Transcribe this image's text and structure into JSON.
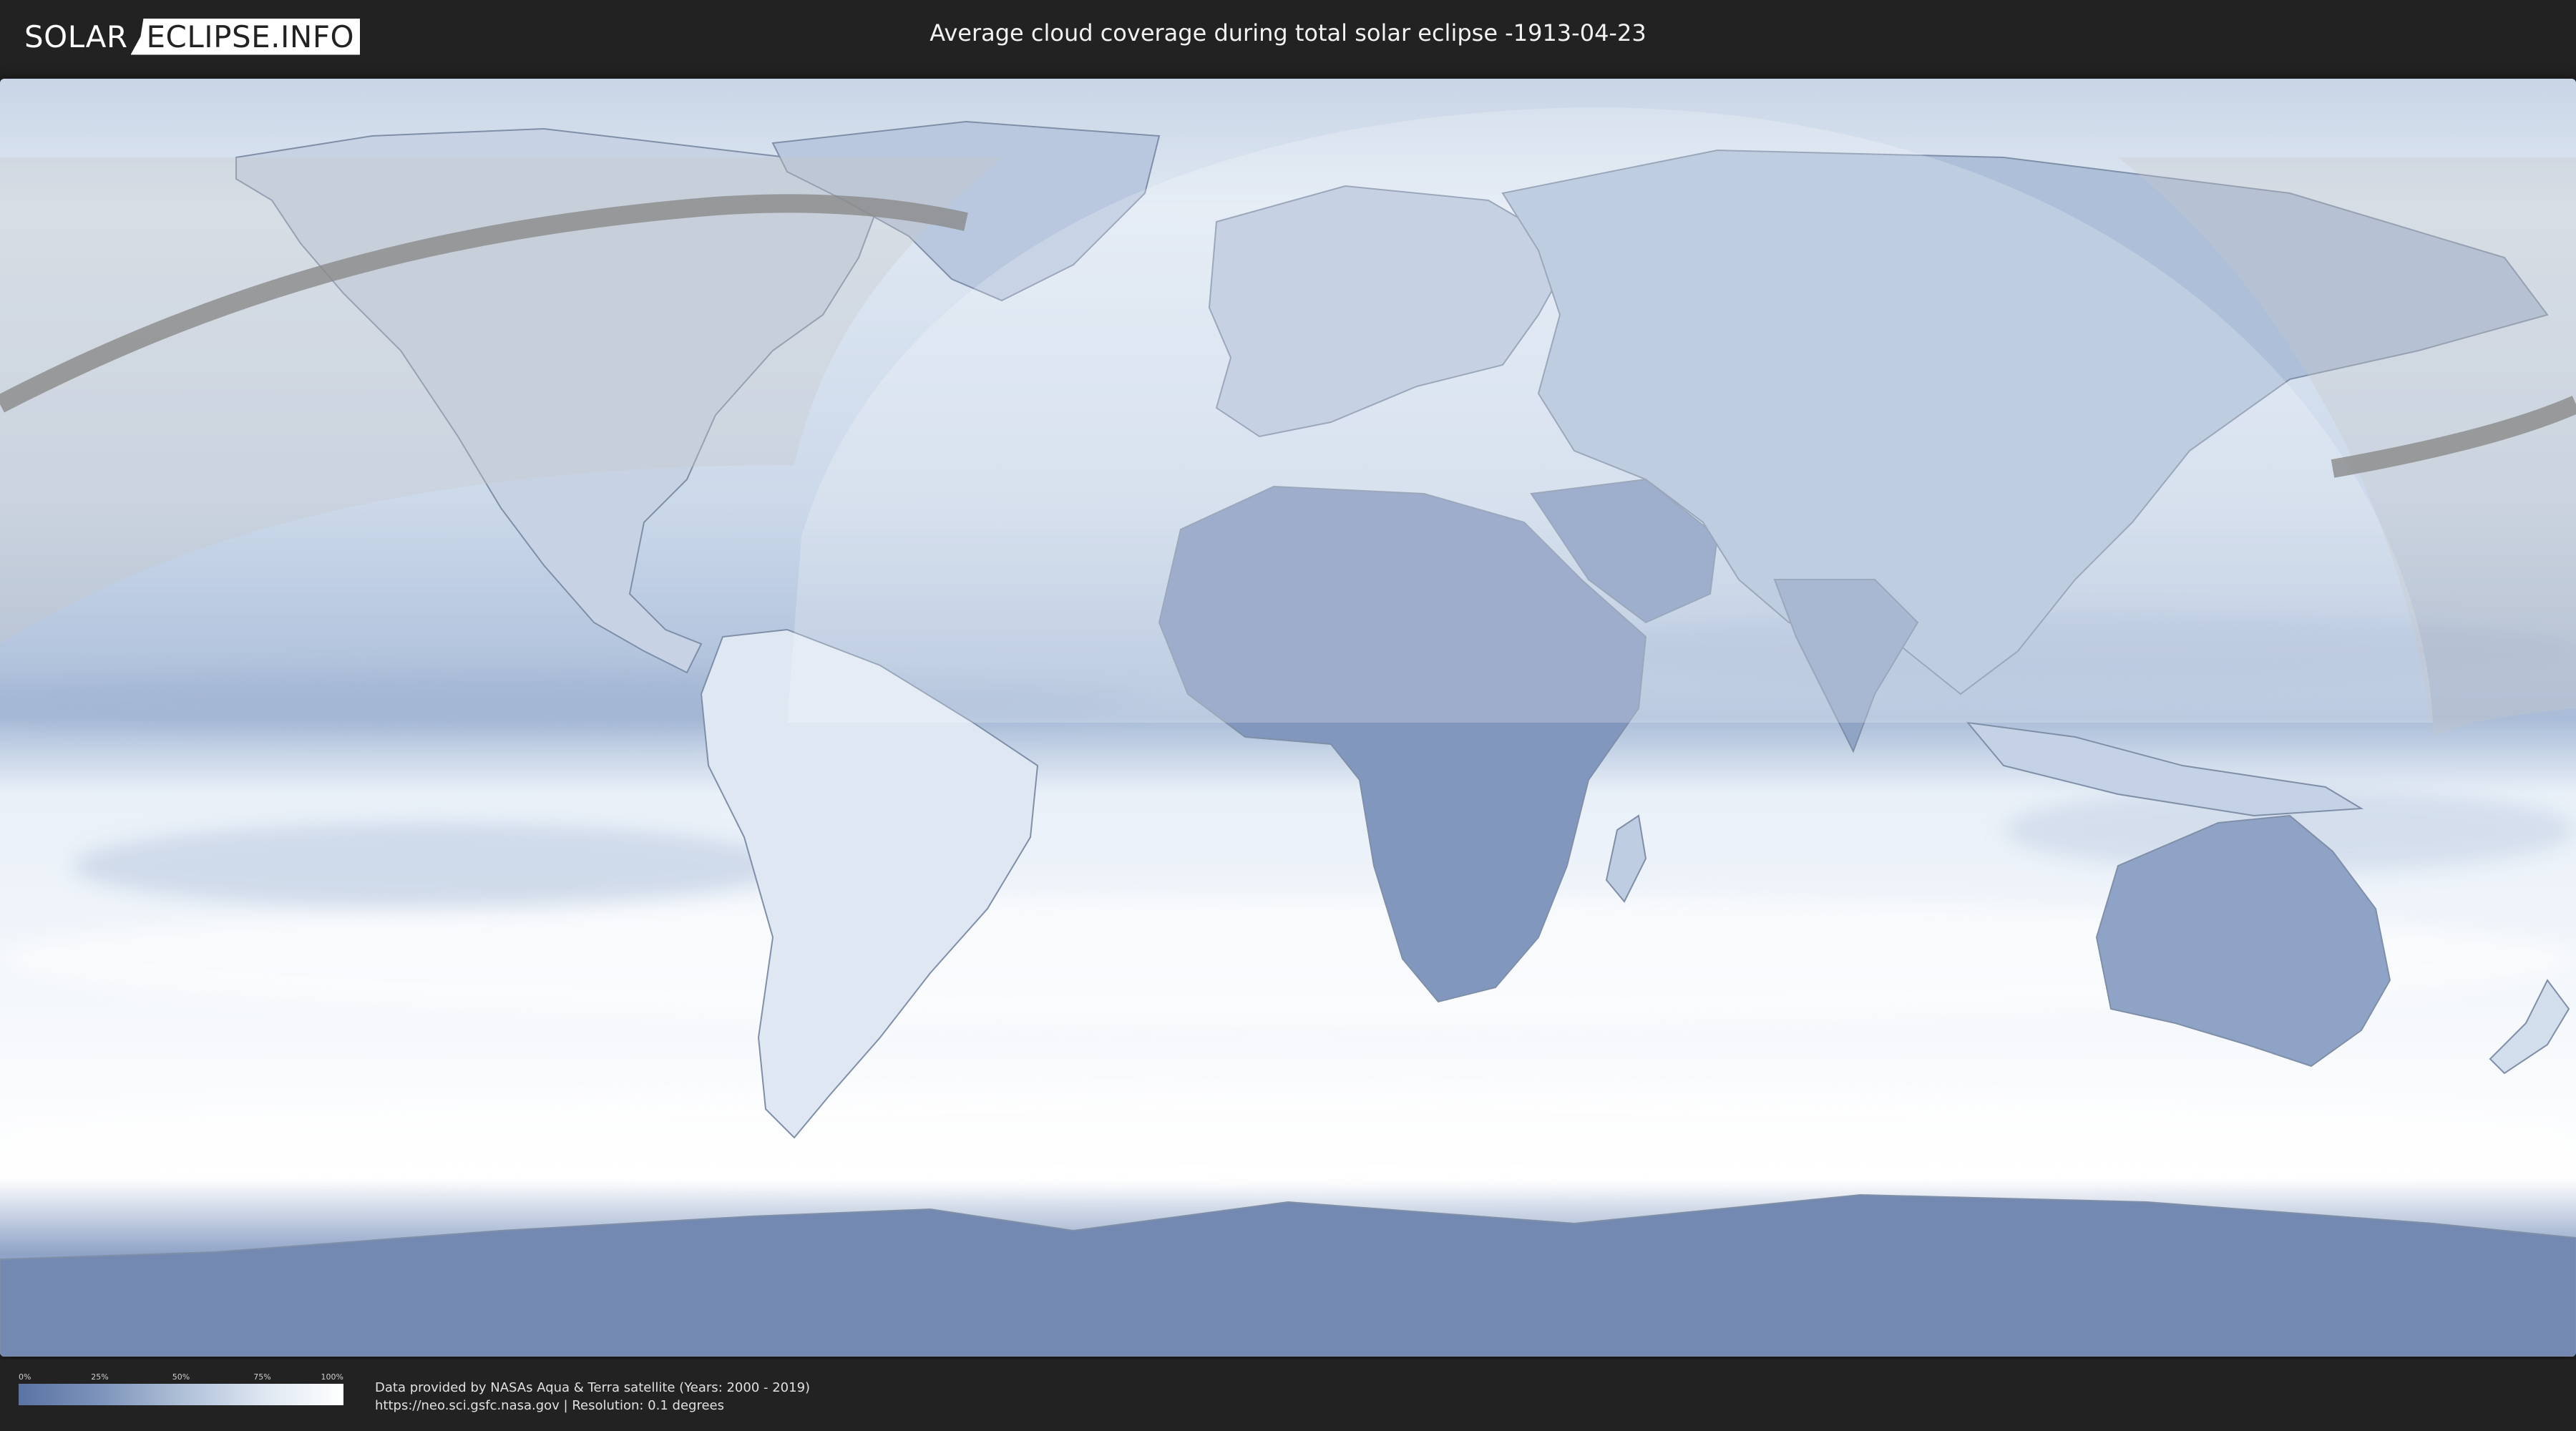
{
  "logo": {
    "left": "SOLAR",
    "right": "ECLIPSE.INFO"
  },
  "title": "Average cloud coverage during total solar eclipse -1913-04-23",
  "legend": {
    "ticks": [
      "0%",
      "25%",
      "50%",
      "75%",
      "100%"
    ],
    "colors": [
      "#5a73a3",
      "#7d93bb",
      "#aebfd7",
      "#dde6f1",
      "#ffffff"
    ]
  },
  "credits": {
    "line1": "Data provided by NASAs Aqua & Terra satellite (Years: 2000 - 2019)",
    "line2": "https://neo.sci.gsfc.nasa.gov | Resolution: 0.1 degrees"
  },
  "map": {
    "ocean_color": "#e3ebf5",
    "cloud_low_color": "#6f86b0",
    "eclipse_path_color": "#8a8a8a",
    "visibility_shade_color": "#c8c8c8"
  }
}
